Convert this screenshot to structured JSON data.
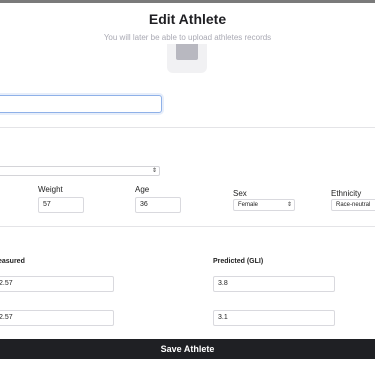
{
  "header": {
    "title": "Edit Athlete",
    "subtitle": "You will later be able to upload athletes records"
  },
  "athlete": {
    "name_value": "",
    "selector_value": "",
    "weight_label": "Weight",
    "weight_value": "57",
    "age_label": "Age",
    "age_value": "36",
    "sex_label": "Sex",
    "sex_value": "Female",
    "ethnicity_label": "Ethnicity",
    "ethnicity_value": "Race-neutral"
  },
  "records": {
    "measured_label": "easured",
    "predicted_label": "Predicted (GLI)",
    "rows": [
      {
        "measured": "2.57",
        "predicted": "3.8"
      },
      {
        "measured": "2.57",
        "predicted": "3.1"
      }
    ]
  },
  "footer": {
    "save_label": "Save Athlete"
  },
  "icons": {
    "select_caret": "chevron-updown-icon",
    "avatar": "image-icon"
  }
}
